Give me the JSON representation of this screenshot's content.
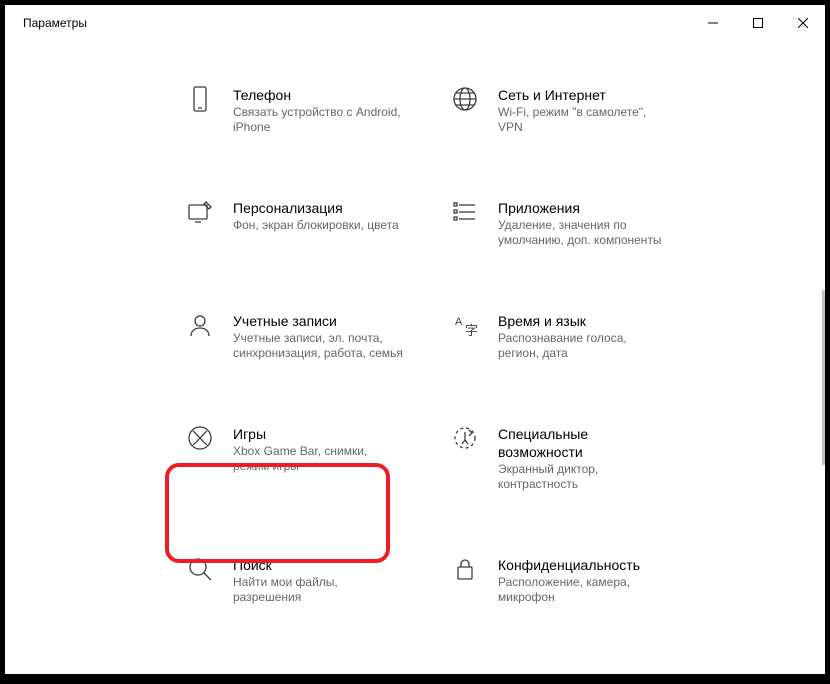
{
  "window": {
    "title": "Параметры"
  },
  "items": [
    {
      "title": "Телефон",
      "desc": "Связать устройство с Android, iPhone"
    },
    {
      "title": "Сеть и Интернет",
      "desc": "Wi-Fi, режим \"в самолете\", VPN"
    },
    {
      "title": "Персонализация",
      "desc": "Фон, экран блокировки, цвета"
    },
    {
      "title": "Приложения",
      "desc": "Удаление, значения по умолчанию, доп. компоненты"
    },
    {
      "title": "Учетные записи",
      "desc": "Учетные записи, эл. почта, синхронизация, работа, семья"
    },
    {
      "title": "Время и язык",
      "desc": "Распознавание голоса, регион, дата"
    },
    {
      "title": "Игры",
      "desc": "Xbox Game Bar, снимки, режим игры"
    },
    {
      "title": "Специальные возможности",
      "desc": "Экранный диктор, контрастность"
    },
    {
      "title": "Поиск",
      "desc": "Найти мои файлы, разрешения"
    },
    {
      "title": "Конфиденциальность",
      "desc": "Расположение, камера, микрофон"
    }
  ]
}
